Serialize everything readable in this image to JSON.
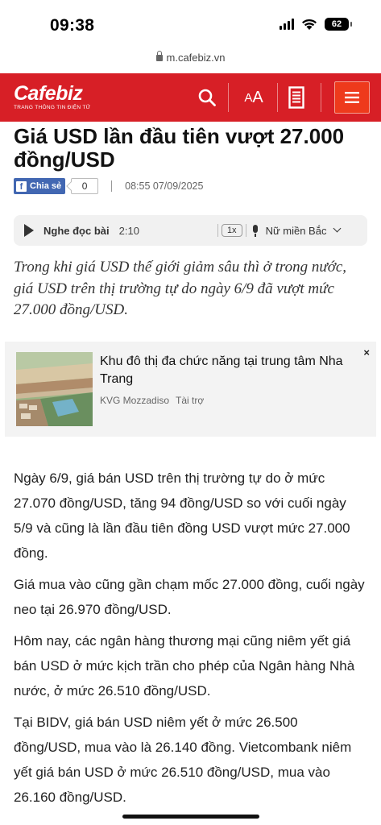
{
  "status_bar": {
    "time": "09:38",
    "battery": "62",
    "icons": [
      "signal-icon",
      "wifi-icon",
      "battery-icon"
    ]
  },
  "browser": {
    "url": "m.cafebiz.vn"
  },
  "header": {
    "logo": "Cafebiz",
    "tagline": "TRANG THÔNG TIN ĐIỆN TỬ",
    "font_size_label_small": "A",
    "font_size_label_large": "A",
    "bg_color": "#d71f26",
    "menu_color": "#ee3a1c",
    "icons": [
      "search-icon",
      "document-icon",
      "menu-icon"
    ]
  },
  "article": {
    "title": "Giá USD lần đầu tiên vượt 27.000 đồng/USD",
    "share_label": "Chia sẻ",
    "share_count": "0",
    "date": "08:55 07/09/2025",
    "audio": {
      "label": "Nghe đọc bài",
      "duration": "2:10",
      "speed": "1x",
      "voice": "Nữ miền Bắc"
    },
    "sapo": "Trong khi giá USD thế giới giảm sâu thì ở trong nước, giá USD trên thị trường tự do ngày 6/9 đã vượt mức 27.000 đồng/USD.",
    "paragraphs": [
      "Ngày 6/9, giá bán USD trên thị trường tự do ở mức 27.070 đồng/USD, tăng 94 đồng/USD so với cuối ngày 5/9 và cũng là lần đầu tiên đồng USD vượt mức 27.000 đồng.",
      "Giá mua vào cũng gần chạm mốc 27.000 đồng, cuối ngày neo tại 26.970 đồng/USD.",
      "Hôm nay, các ngân hàng thương mại cũng niêm yết giá bán USD ở mức kịch trần cho phép của Ngân hàng Nhà nước, ở mức 26.510 đồng/USD.",
      "Tại BIDV, giá bán USD niêm yết ở mức 26.500 đồng/USD, mua vào là 26.140 đồng. Vietcombank niêm yết giá bán USD ở mức 26.510 đồng/USD, mua vào 26.160 đồng/USD."
    ]
  },
  "ad": {
    "title": "Khu đô thị đa chức năng tại trung tâm Nha Trang",
    "advertiser": "KVG Mozzadiso",
    "sponsored": "Tài trợ",
    "close": "×"
  }
}
